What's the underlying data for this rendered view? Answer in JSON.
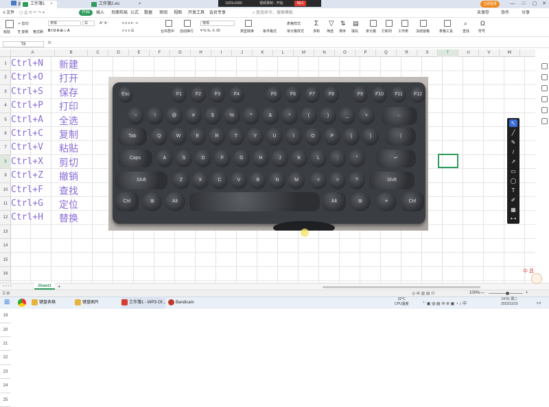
{
  "titlebar": {
    "tabs": [
      {
        "label": "工作簿1"
      },
      {
        "label": "工作簿2.xls"
      }
    ],
    "recording": {
      "resolution": "1920x1080",
      "status": "视频录制 - 开始",
      "rec": "REC"
    },
    "user": "立即登录"
  },
  "menu": {
    "file": "文件",
    "items": [
      "开始",
      "插入",
      "页面布局",
      "公式",
      "数据",
      "审阅",
      "视图",
      "开发工具",
      "会员专享"
    ],
    "search": "查找命令、搜索模板",
    "unsaved": "未保存",
    "collab": "协作",
    "share": "分享"
  },
  "toolbar": {
    "paste": "粘贴",
    "cut": "剪切",
    "copy": "复制",
    "format_painter": "格式刷",
    "font": "宋体",
    "font_size": "11",
    "merge": "合并居中",
    "wrap": "自动换行",
    "numfmt": "常规",
    "convert": "类型转换",
    "cond_format": "条件格式",
    "table_style": "表格样式",
    "cell_style": "单元格样式",
    "sum": "求和",
    "filter": "筛选",
    "sort": "排序",
    "fill": "填充",
    "cell": "单元格",
    "rowcol": "行和列",
    "worksheet": "工作表",
    "freeze": "冻结窗格",
    "table_tools": "表格工具",
    "find": "查找",
    "symbol": "符号"
  },
  "formula": {
    "namebox": "T8",
    "fx": "fx"
  },
  "grid": {
    "columns": [
      "A",
      "B",
      "C",
      "D",
      "E",
      "F",
      "G",
      "H",
      "I",
      "J",
      "K",
      "L",
      "M",
      "N",
      "O",
      "P",
      "Q",
      "R",
      "S",
      "T",
      "U",
      "V",
      "W"
    ],
    "rows": [
      "1",
      "2",
      "3",
      "4",
      "5",
      "6",
      "7",
      "8",
      "9",
      "10",
      "11",
      "12",
      "13",
      "14",
      "15",
      "16",
      "17",
      "18",
      "19",
      "20",
      "21",
      "22",
      "23",
      "24",
      "25"
    ],
    "shortcuts": [
      {
        "key": "Ctrl+N",
        "action": "新建"
      },
      {
        "key": "Ctrl+O",
        "action": "打开"
      },
      {
        "key": "Ctrl+S",
        "action": "保存"
      },
      {
        "key": "Ctrl+P",
        "action": "打印"
      },
      {
        "key": "Ctrl+A",
        "action": "全选"
      },
      {
        "key": "Ctrl+C",
        "action": "复制"
      },
      {
        "key": "Ctrl+V",
        "action": "粘贴"
      },
      {
        "key": "Ctrl+X",
        "action": "剪切"
      },
      {
        "key": "Ctrl+Z",
        "action": "撤销"
      },
      {
        "key": "Ctrl+F",
        "action": "查找"
      },
      {
        "key": "Ctrl+G",
        "action": "定位"
      },
      {
        "key": "Ctrl+H",
        "action": "替换"
      }
    ]
  },
  "keyboard": {
    "row1": [
      "Esc",
      "F1",
      "F2",
      "F3",
      "F4",
      "F5",
      "F6",
      "F7",
      "F8",
      "F9",
      "F10",
      "F11",
      "F12"
    ],
    "row2": [
      "~",
      "!",
      "@",
      "#",
      "$",
      "%",
      "^",
      "&",
      "*",
      "(",
      ")",
      "_",
      "+",
      "←"
    ],
    "row3": [
      "Tab",
      "Q",
      "W",
      "E",
      "R",
      "T",
      "Y",
      "U",
      "I",
      "O",
      "P",
      "{",
      "}",
      "|"
    ],
    "row4": [
      "Caps",
      "A",
      "S",
      "D",
      "F",
      "G",
      "H",
      "J",
      "K",
      "L",
      ":",
      "\"",
      "↵"
    ],
    "row5": [
      "Shift",
      "Z",
      "X",
      "C",
      "V",
      "B",
      "N",
      "M",
      "<",
      ">",
      "?",
      "Shift"
    ],
    "row6": [
      "Ctrl",
      "⊞",
      "Alt",
      "",
      "Alt",
      "⊞",
      "≡",
      "Ctrl"
    ]
  },
  "sheets": {
    "active": "Sheet1",
    "add": "+"
  },
  "status": {
    "zoom": "100%"
  },
  "taskbar": {
    "apps": [
      "键盘表格",
      "键盘图片",
      "工作簿1 - WPS Of...",
      "Bandicam"
    ],
    "temp": "32°C",
    "cpu": "CPU温度",
    "time": "14:51 周二",
    "date": "2022/11/15"
  },
  "mascot_text": "中 具"
}
